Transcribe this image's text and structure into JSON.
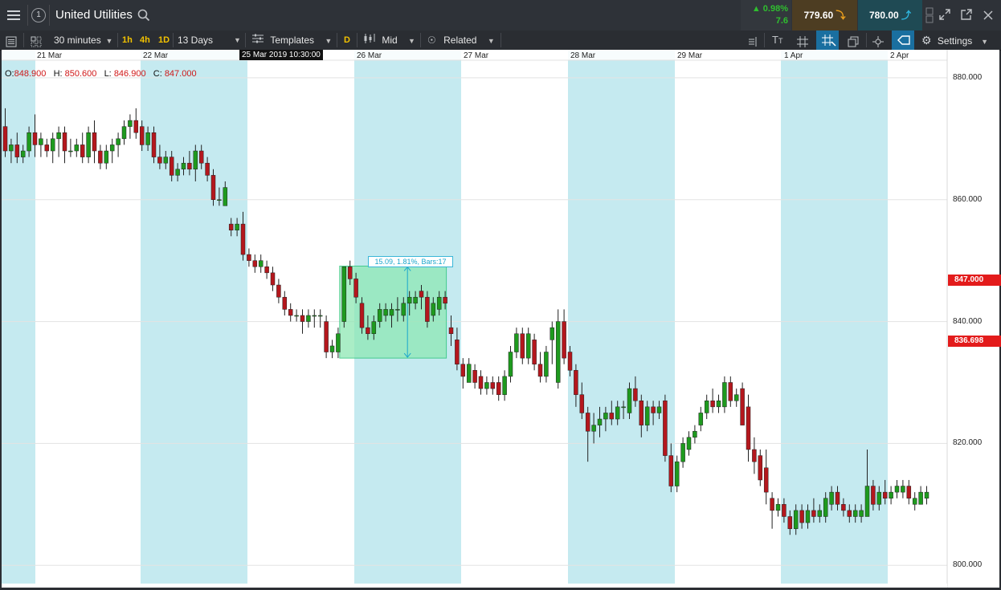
{
  "header": {
    "instrument": "United Utilities",
    "watch_number": "1",
    "change_pct": "▲ 0.98%",
    "change_abs": "7.6",
    "sell_price": "779.60",
    "buy_price": "780.00"
  },
  "toolbar": {
    "interval": "30 minutes",
    "quick_1h": "1h",
    "quick_4h": "4h",
    "quick_1d": "1D",
    "range": "13 Days",
    "templates": "Templates",
    "d_btn": "D",
    "price_mode": "Mid",
    "related": "Related",
    "settings": "Settings"
  },
  "ohlc": {
    "o_label": "O:",
    "o": "848.900",
    "h_label": "H:",
    "h": "850.600",
    "l_label": "L:",
    "l": "846.900",
    "c_label": "C:",
    "c": "847.000"
  },
  "chart_data": {
    "type": "candlestick",
    "x_labels": [
      "21 Mar",
      "22 Mar",
      "26 Mar",
      "27 Mar",
      "28 Mar",
      "29 Mar",
      "1 Apr",
      "2 Apr"
    ],
    "crosshair_x_label": "25 Mar 2019 10:30:00",
    "y_ticks": [
      "880.000",
      "860.000",
      "840.000",
      "820.000",
      "800.000"
    ],
    "ylim": [
      797,
      884.6
    ],
    "price_tags": [
      "847.000",
      "836.698"
    ],
    "measurement_label": "15.09, 1.81%, Bars:17",
    "grid": true,
    "colors": {
      "up": "#1e9a1e",
      "down": "#b4171d",
      "shade": "#c5eaf0",
      "measure": "#8ee8b4",
      "tag": "#e31b1b"
    },
    "candles": [
      [
        0,
        872,
        875,
        867,
        868
      ],
      [
        1,
        868,
        870,
        866,
        869
      ],
      [
        2,
        869,
        871,
        866,
        867
      ],
      [
        3,
        867,
        869,
        866,
        868
      ],
      [
        4,
        868,
        872,
        867,
        871
      ],
      [
        5,
        871,
        874,
        867,
        869
      ],
      [
        6,
        869,
        871,
        867,
        870
      ],
      [
        7,
        869,
        870,
        867,
        868
      ],
      [
        8,
        868,
        871,
        866,
        870
      ],
      [
        9,
        870,
        872,
        867,
        871
      ],
      [
        10,
        871,
        872,
        866,
        868
      ],
      [
        11,
        868,
        870,
        867,
        868
      ],
      [
        12,
        868,
        870,
        867,
        869
      ],
      [
        13,
        869,
        871,
        866,
        867
      ],
      [
        14,
        867,
        872,
        866,
        871
      ],
      [
        15,
        871,
        873,
        866,
        868
      ],
      [
        16,
        868,
        869,
        865,
        866
      ],
      [
        17,
        866,
        869,
        865,
        868
      ],
      [
        18,
        868,
        870,
        866,
        869
      ],
      [
        19,
        869,
        871,
        867,
        870
      ],
      [
        20,
        870,
        873,
        869,
        872
      ],
      [
        21,
        872,
        874,
        870,
        873
      ],
      [
        22,
        873,
        875,
        870,
        871
      ],
      [
        23,
        872,
        873,
        868,
        869
      ],
      [
        24,
        869,
        872,
        868,
        871
      ],
      [
        25,
        871,
        872,
        866,
        867
      ],
      [
        26,
        867,
        869,
        865,
        866
      ],
      [
        27,
        866,
        868,
        865,
        867
      ],
      [
        28,
        867,
        868,
        863,
        864
      ],
      [
        29,
        864,
        866,
        863,
        865
      ],
      [
        30,
        865,
        867,
        864,
        866
      ],
      [
        31,
        866,
        868,
        864,
        865
      ],
      [
        32,
        865,
        869,
        863,
        868
      ],
      [
        33,
        868,
        869,
        865,
        866
      ],
      [
        34,
        866,
        867,
        863,
        864
      ],
      [
        35,
        864,
        865,
        859,
        860
      ],
      [
        36,
        860,
        862,
        859,
        860
      ],
      [
        37,
        859,
        863,
        859,
        862
      ],
      [
        38,
        856,
        857,
        854,
        855
      ],
      [
        39,
        855,
        857,
        854,
        856
      ],
      [
        40,
        856,
        858,
        850,
        851
      ],
      [
        41,
        851,
        852,
        849,
        850
      ],
      [
        42,
        850,
        851,
        848,
        849
      ],
      [
        43,
        849,
        851,
        848,
        850
      ],
      [
        44,
        849,
        850,
        847,
        848
      ],
      [
        45,
        848,
        849,
        845,
        846
      ],
      [
        46,
        846,
        847,
        843,
        844
      ],
      [
        47,
        844,
        845,
        841,
        842
      ],
      [
        48,
        842,
        843,
        840,
        841
      ],
      [
        49,
        841,
        842,
        840,
        841
      ],
      [
        50,
        841,
        842,
        838,
        840
      ],
      [
        51,
        840,
        842,
        839,
        841
      ],
      [
        52,
        841,
        842,
        839,
        841
      ],
      [
        53,
        841,
        842,
        839,
        841
      ],
      [
        54,
        840,
        841,
        834,
        835
      ],
      [
        55,
        835,
        837,
        834,
        836
      ],
      [
        56,
        835,
        839,
        834,
        838
      ],
      [
        57,
        840,
        849,
        839,
        849
      ],
      [
        58,
        849,
        850,
        846,
        847
      ],
      [
        59,
        847,
        848,
        843,
        844
      ],
      [
        60,
        843,
        844,
        838,
        839
      ],
      [
        61,
        839,
        841,
        837,
        838
      ],
      [
        62,
        838,
        841,
        837,
        840
      ],
      [
        63,
        840,
        843,
        839,
        842
      ],
      [
        64,
        841,
        843,
        840,
        842
      ],
      [
        65,
        841,
        843,
        839,
        842
      ],
      [
        66,
        842,
        844,
        840,
        842
      ],
      [
        67,
        841,
        844,
        840,
        843
      ],
      [
        68,
        843,
        845,
        841,
        844
      ],
      [
        69,
        843,
        845,
        842,
        844
      ],
      [
        70,
        845,
        846,
        842,
        844
      ],
      [
        71,
        844,
        845,
        839,
        840
      ],
      [
        72,
        841,
        844,
        840,
        843
      ],
      [
        73,
        842,
        845,
        841,
        844
      ],
      [
        74,
        844,
        845,
        842,
        843
      ],
      [
        75,
        839,
        841,
        836,
        838
      ],
      [
        76,
        837,
        839,
        832,
        833
      ],
      [
        77,
        833,
        834,
        829,
        831
      ],
      [
        78,
        830,
        834,
        830,
        833
      ],
      [
        79,
        832,
        833,
        829,
        830
      ],
      [
        80,
        831,
        832,
        828,
        829
      ],
      [
        81,
        829,
        831,
        828,
        830
      ],
      [
        82,
        830,
        831,
        828,
        829
      ],
      [
        83,
        830,
        831,
        827,
        828
      ],
      [
        84,
        828,
        832,
        827,
        831
      ],
      [
        85,
        831,
        836,
        830,
        835
      ],
      [
        86,
        835,
        839,
        834,
        838
      ],
      [
        87,
        838,
        839,
        833,
        834
      ],
      [
        88,
        834,
        839,
        833,
        838
      ],
      [
        89,
        837,
        838,
        832,
        833
      ],
      [
        90,
        833,
        835,
        830,
        831
      ],
      [
        91,
        831,
        836,
        830,
        835
      ],
      [
        92,
        837,
        840,
        833,
        839
      ],
      [
        93,
        830,
        842,
        829,
        840
      ],
      [
        94,
        840,
        842,
        833,
        834
      ],
      [
        95,
        835,
        836,
        831,
        832
      ],
      [
        96,
        832,
        833,
        826,
        828
      ],
      [
        97,
        828,
        830,
        824,
        825
      ],
      [
        98,
        825,
        826,
        817,
        822
      ],
      [
        99,
        822,
        825,
        820,
        823
      ],
      [
        100,
        823,
        826,
        821,
        824
      ],
      [
        101,
        824,
        826,
        822,
        825
      ],
      [
        102,
        825,
        827,
        823,
        824
      ],
      [
        103,
        824,
        827,
        823,
        826
      ],
      [
        104,
        826,
        827,
        824,
        826
      ],
      [
        105,
        825,
        830,
        824,
        829
      ],
      [
        106,
        829,
        831,
        826,
        827
      ],
      [
        107,
        827,
        828,
        821,
        823
      ],
      [
        108,
        823,
        827,
        822,
        826
      ],
      [
        109,
        826,
        827,
        823,
        825
      ],
      [
        110,
        825,
        827,
        824,
        826
      ],
      [
        111,
        827,
        828,
        817,
        818
      ],
      [
        112,
        818,
        820,
        812,
        813
      ],
      [
        113,
        813,
        818,
        812,
        817
      ],
      [
        114,
        817,
        821,
        816,
        820
      ],
      [
        115,
        819,
        822,
        818,
        821
      ],
      [
        116,
        821,
        823,
        820,
        822
      ],
      [
        117,
        823,
        826,
        822,
        825
      ],
      [
        118,
        825,
        828,
        824,
        827
      ],
      [
        119,
        827,
        829,
        825,
        826
      ],
      [
        120,
        826,
        828,
        825,
        827
      ],
      [
        121,
        826,
        831,
        825,
        830
      ],
      [
        122,
        830,
        831,
        826,
        827
      ],
      [
        123,
        827,
        829,
        826,
        828
      ],
      [
        124,
        829,
        830,
        823,
        823
      ],
      [
        125,
        826,
        828,
        817,
        819
      ],
      [
        126,
        819,
        821,
        815,
        817
      ],
      [
        127,
        818,
        819,
        813,
        814
      ],
      [
        128,
        816,
        819,
        810,
        812
      ],
      [
        129,
        811,
        812,
        806,
        809
      ],
      [
        130,
        809,
        811,
        808,
        810
      ],
      [
        131,
        810,
        811,
        807,
        808
      ],
      [
        132,
        808,
        809,
        805,
        806
      ],
      [
        133,
        806,
        810,
        805,
        809
      ],
      [
        134,
        809,
        810,
        806,
        807
      ],
      [
        135,
        807,
        810,
        806,
        809
      ],
      [
        136,
        809,
        811,
        807,
        808
      ],
      [
        137,
        808,
        810,
        807,
        809
      ],
      [
        138,
        808,
        812,
        807,
        811
      ],
      [
        139,
        810,
        813,
        809,
        812
      ],
      [
        140,
        812,
        813,
        809,
        810
      ],
      [
        141,
        810,
        811,
        808,
        809
      ],
      [
        142,
        809,
        810,
        807,
        808
      ],
      [
        143,
        808,
        810,
        807,
        809
      ],
      [
        144,
        808,
        810,
        807,
        809
      ],
      [
        145,
        808,
        819,
        808,
        813
      ],
      [
        146,
        813,
        814,
        809,
        810
      ],
      [
        147,
        810,
        813,
        809,
        812
      ],
      [
        148,
        812,
        814,
        810,
        811
      ],
      [
        149,
        811,
        813,
        810,
        812
      ],
      [
        150,
        812,
        814,
        811,
        813
      ],
      [
        151,
        812,
        814,
        811,
        813
      ],
      [
        152,
        813,
        814,
        810,
        811
      ],
      [
        153,
        810,
        812,
        809,
        811
      ],
      [
        154,
        810,
        813,
        810,
        812
      ],
      [
        155,
        811,
        813,
        810,
        812
      ]
    ]
  }
}
